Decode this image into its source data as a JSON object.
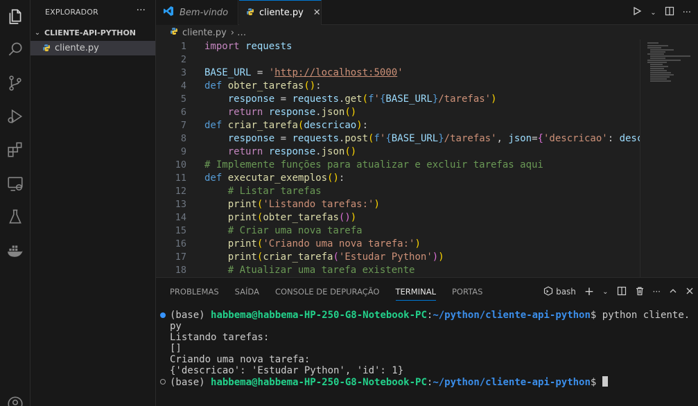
{
  "sidebar": {
    "title": "EXPLORADOR",
    "more": "···",
    "folder": "CLIENTE-API-PYTHON",
    "file": "cliente.py"
  },
  "tabs": {
    "welcome": "Bem-vindo",
    "active": "cliente.py",
    "close": "✕"
  },
  "breadcrumb": {
    "file": "cliente.py",
    "sep": "› …"
  },
  "editor": {
    "line_numbers": [
      "1",
      "2",
      "3",
      "4",
      "5",
      "6",
      "7",
      "8",
      "9",
      "10",
      "11",
      "12",
      "13",
      "14",
      "15",
      "16",
      "17",
      "18"
    ]
  },
  "panel": {
    "tabs": [
      "PROBLEMAS",
      "SAÍDA",
      "CONSOLE DE DEPURAÇÃO",
      "TERMINAL",
      "PORTAS"
    ],
    "shell": "bash",
    "terminal": {
      "prompt_env": "(base) ",
      "user_host": "habbema@habbema-HP-250-G8-Notebook-PC",
      "colon": ":",
      "path": "~/python/cliente-api-python",
      "dollar": "$ ",
      "command": "python cliente.",
      "command_wrap": "py",
      "out1": "Listando tarefas:",
      "out2": "[]",
      "out3": "Criando uma nova tarefa:",
      "out4": "{'descricao': 'Estudar Python', 'id': 1}"
    }
  },
  "colors": {
    "accent": "#0078d4",
    "keyword": "#569cd6",
    "function": "#dcdcaa",
    "string": "#ce9178",
    "comment": "#6a9955",
    "terminal_user": "#23d18b",
    "terminal_path": "#3b8eea"
  }
}
